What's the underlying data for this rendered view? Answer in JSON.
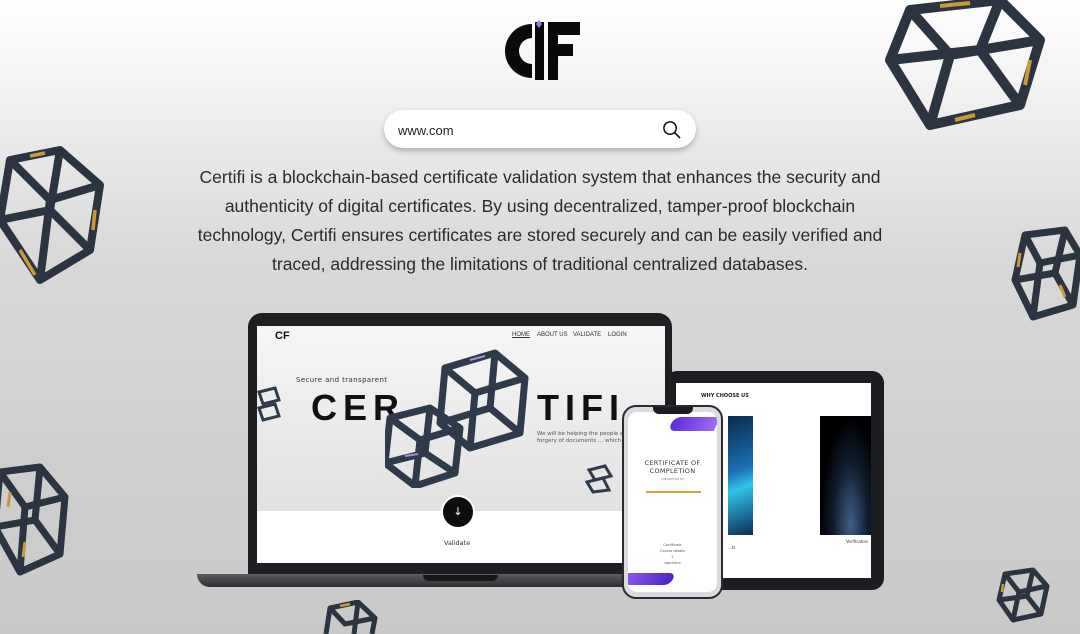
{
  "brand": {
    "logo_text": "CF"
  },
  "search": {
    "value": "www.com"
  },
  "description": "Certifi is a blockchain-based certificate validation system that enhances the security and authenticity of digital certificates. By using decentralized, tamper-proof blockchain technology, Certifi ensures certificates are stored securely and can be easily verified and traced, addressing the limitations of traditional centralized databases.",
  "laptop": {
    "logo_text": "CF",
    "nav": [
      {
        "label": "HOME",
        "active": true
      },
      {
        "label": "ABOUT US",
        "active": false
      },
      {
        "label": "VALIDATE",
        "active": false
      },
      {
        "label": "LOGIN",
        "active": false
      }
    ],
    "tagline": "Secure and transparent",
    "headline_left": "CER",
    "headline_right": "TIFI",
    "hero_sub": "We will be helping the people e... fake forgery of documents ... which we us...",
    "scroll_button": "↓",
    "validate_label": "Validate"
  },
  "tablet": {
    "section_title": "WHY CHOOSE US",
    "caption_1": "...ts",
    "caption_2": "Verification"
  },
  "phone": {
    "certificate_title": "CERTIFICATE OF COMPLETION",
    "certificate_sub": "presented to",
    "footer_line_1": "Certificate",
    "footer_line_2": "Course details",
    "footer_line_3": "2",
    "footer_line_4": "signature"
  },
  "colors": {
    "accent_purple": "#6a3be4",
    "accent_gold": "#d7a23e",
    "device_dark": "#1e1f22"
  }
}
